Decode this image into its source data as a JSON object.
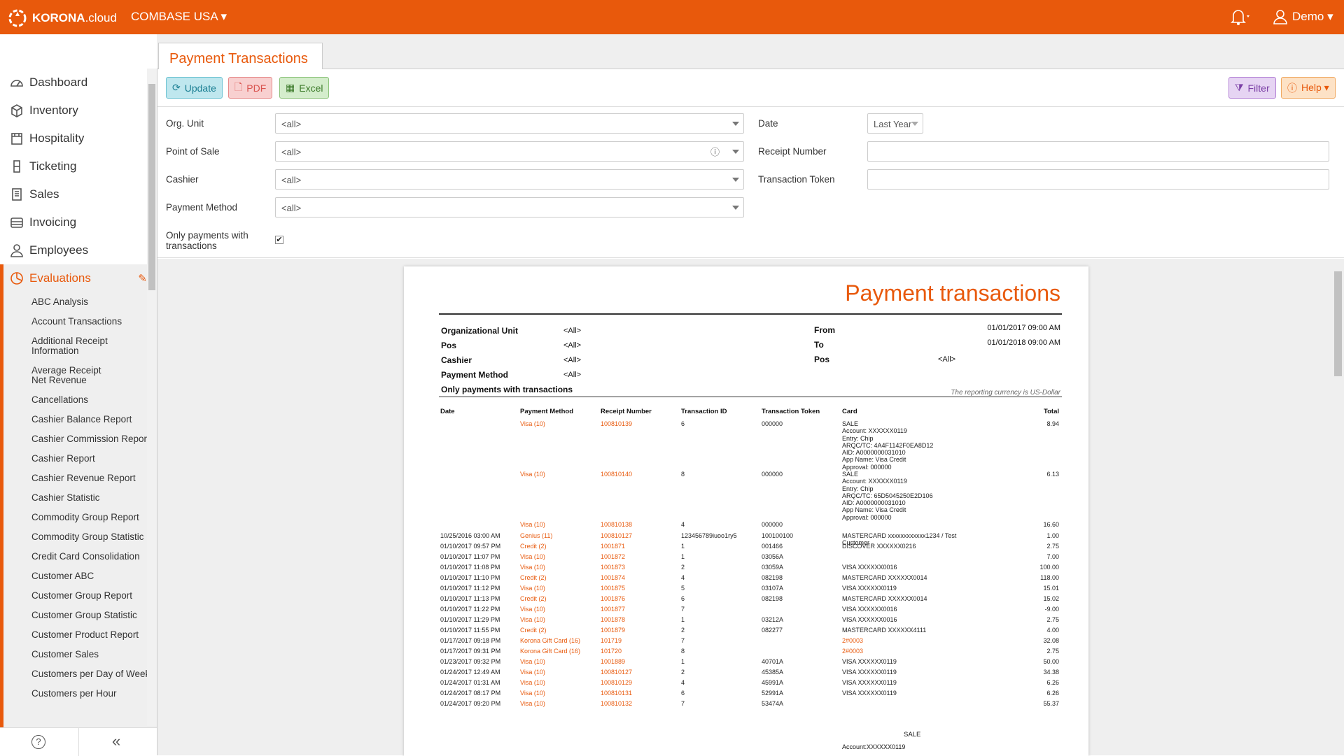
{
  "topbar": {
    "logo_brand": "KORONA",
    "logo_suffix": ".cloud",
    "company": "COMBASE USA ▾",
    "bell": "🔔▾",
    "user": "Demo ▾"
  },
  "sidebar": {
    "items": [
      {
        "label": "Dashboard",
        "icon": "dashboard-icon"
      },
      {
        "label": "Inventory",
        "icon": "box-icon"
      },
      {
        "label": "Hospitality",
        "icon": "hospitality-icon"
      },
      {
        "label": "Ticketing",
        "icon": "ticket-icon"
      },
      {
        "label": "Sales",
        "icon": "sales-icon"
      },
      {
        "label": "Invoicing",
        "icon": "invoice-icon"
      },
      {
        "label": "Employees",
        "icon": "user-icon"
      },
      {
        "label": "Evaluations",
        "icon": "pie-icon",
        "active": true
      }
    ],
    "submenu": [
      "ABC Analysis",
      "Account Transactions",
      "Additional Receipt Information",
      "Average Receipt Net Revenue",
      "Cancellations",
      "Cashier Balance Report",
      "Cashier Commission Report",
      "Cashier Report",
      "Cashier Revenue Report",
      "Cashier Statistic",
      "Commodity Group Report",
      "Commodity Group Statistic",
      "Credit Card Consolidation",
      "Customer ABC",
      "Customer Group Report",
      "Customer Group Statistic",
      "Customer Product Report",
      "Customer Sales",
      "Customers per Day of Week",
      "Customers per Hour"
    ],
    "help": "?",
    "collapse": "«"
  },
  "tab": {
    "title": "Payment Transactions"
  },
  "toolbar": {
    "update": "Update",
    "pdf": "PDF",
    "excel": "Excel",
    "filter": "Filter",
    "help": "Help ▾"
  },
  "form": {
    "org_unit_label": "Org. Unit",
    "org_unit_value": "<all>",
    "pos_label": "Point of Sale",
    "pos_value": "<all>",
    "cashier_label": "Cashier",
    "cashier_value": "<all>",
    "payment_method_label": "Payment Method",
    "payment_method_value": "<all>",
    "only_payments_label_1": "Only payments with",
    "only_payments_label_2": "transactions",
    "only_payments_checked": true,
    "date_label": "Date",
    "date_value": "Last Year",
    "receipt_number_label": "Receipt Number",
    "receipt_number_value": "",
    "transaction_token_label": "Transaction Token",
    "transaction_token_value": ""
  },
  "report": {
    "title": "Payment transactions",
    "params": [
      {
        "label": "Organizational Unit",
        "value": "<All>"
      },
      {
        "label": "Pos",
        "value": "<All>"
      },
      {
        "label": "Cashier",
        "value": "<All>"
      },
      {
        "label": "Payment Method",
        "value": "<All>"
      },
      {
        "label": "Only payments with transactions",
        "value": ""
      }
    ],
    "from_label": "From",
    "from_value": "01/01/2017 09:00 AM",
    "to_label": "To",
    "to_value": "01/01/2018 09:00 AM",
    "pos_label": "Pos",
    "pos_value": "<All>",
    "currency_note": "The reporting currency is US-Dollar",
    "columns": [
      "Date",
      "Payment Method",
      "Receipt Number",
      "Transaction ID",
      "Transaction Token",
      "Card",
      "Total"
    ],
    "rows": [
      {
        "date": "",
        "method": "Visa (10)",
        "receipt": "100810139",
        "tid": "6",
        "token": "000000",
        "card": "SALE\nAccount: XXXXXX0119\nEntry: Chip\nARQC/TC: 4A4F1142F0EA8D12\nAID: A0000000031010\nApp Name: Visa Credit\nApproval: 000000",
        "total": "8.94"
      },
      {
        "date": "",
        "method": "Visa (10)",
        "receipt": "100810140",
        "tid": "8",
        "token": "000000",
        "card": "SALE\nAccount: XXXXXX0119\nEntry: Chip\nARQC/TC: 65D5045250E2D106\nAID: A0000000031010\nApp Name: Visa Credit\nApproval: 000000",
        "total": "6.13"
      },
      {
        "date": "",
        "method": "Visa (10)",
        "receipt": "100810138",
        "tid": "4",
        "token": "000000",
        "card": "",
        "total": "16.60"
      },
      {
        "date": "10/25/2016 03:00 AM",
        "method": "Genius (11)",
        "receipt": "100810127",
        "tid": "123456789iuoo1ry5",
        "token": "100100100",
        "card": "MASTERCARD xxxxxxxxxxxx1234 / Test\nCustomer",
        "total": "1.00"
      },
      {
        "date": "01/10/2017 09:57 PM",
        "method": "Credit (2)",
        "receipt": "1001871",
        "tid": "1",
        "token": "001466",
        "card": "DISCOVER XXXXXX0216",
        "total": "2.75"
      },
      {
        "date": "01/10/2017 11:07 PM",
        "method": "Visa (10)",
        "receipt": "1001872",
        "tid": "1",
        "token": "03056A",
        "card": "",
        "total": "7.00"
      },
      {
        "date": "01/10/2017 11:08 PM",
        "method": "Visa (10)",
        "receipt": "1001873",
        "tid": "2",
        "token": "03059A",
        "card": "VISA XXXXXX0016",
        "total": "100.00"
      },
      {
        "date": "01/10/2017 11:10 PM",
        "method": "Credit (2)",
        "receipt": "1001874",
        "tid": "4",
        "token": "082198",
        "card": "MASTERCARD XXXXXX0014",
        "total": "118.00"
      },
      {
        "date": "01/10/2017 11:12 PM",
        "method": "Visa (10)",
        "receipt": "1001875",
        "tid": "5",
        "token": "03107A",
        "card": "VISA XXXXXX0119",
        "total": "15.01"
      },
      {
        "date": "01/10/2017 11:13 PM",
        "method": "Credit (2)",
        "receipt": "1001876",
        "tid": "6",
        "token": "082198",
        "card": "MASTERCARD XXXXXX0014",
        "total": "15.02"
      },
      {
        "date": "01/10/2017 11:22 PM",
        "method": "Visa (10)",
        "receipt": "1001877",
        "tid": "7",
        "token": "",
        "card": "VISA XXXXXX0016",
        "total": "-9.00"
      },
      {
        "date": "01/10/2017 11:29 PM",
        "method": "Visa (10)",
        "receipt": "1001878",
        "tid": "1",
        "token": "03212A",
        "card": "VISA XXXXXX0016",
        "total": "2.75"
      },
      {
        "date": "01/10/2017 11:55 PM",
        "method": "Credit (2)",
        "receipt": "1001879",
        "tid": "2",
        "token": "082277",
        "card": "MASTERCARD XXXXXX4111",
        "total": "4.00"
      },
      {
        "date": "01/17/2017 09:18 PM",
        "method": "Korona Gift Card (16)",
        "receipt": "101719",
        "tid": "7",
        "token": "",
        "card": "2#0003",
        "total": "32.08"
      },
      {
        "date": "01/17/2017 09:31 PM",
        "method": "Korona Gift Card (16)",
        "receipt": "101720",
        "tid": "8",
        "token": "",
        "card": "2#0003",
        "total": "2.75"
      },
      {
        "date": "01/23/2017 09:32 PM",
        "method": "Visa (10)",
        "receipt": "1001889",
        "tid": "1",
        "token": "40701A",
        "card": "VISA XXXXXX0119",
        "total": "50.00"
      },
      {
        "date": "01/24/2017 12:49 AM",
        "method": "Visa (10)",
        "receipt": "100810127",
        "tid": "2",
        "token": "45385A",
        "card": "VISA XXXXXX0119",
        "total": "34.38"
      },
      {
        "date": "01/24/2017 01:31 AM",
        "method": "Visa (10)",
        "receipt": "100810129",
        "tid": "4",
        "token": "45991A",
        "card": "VISA XXXXXX0119",
        "total": "6.26"
      },
      {
        "date": "01/24/2017 08:17 PM",
        "method": "Visa (10)",
        "receipt": "100810131",
        "tid": "6",
        "token": "52991A",
        "card": "VISA XXXXXX0119",
        "total": "6.26"
      },
      {
        "date": "01/24/2017 09:20 PM",
        "method": "Visa (10)",
        "receipt": "100810132",
        "tid": "7",
        "token": "53474A",
        "card": "",
        "total": "55.37"
      }
    ],
    "trailing_sale": "SALE",
    "trailing_account": "Account:XXXXXX0119"
  }
}
